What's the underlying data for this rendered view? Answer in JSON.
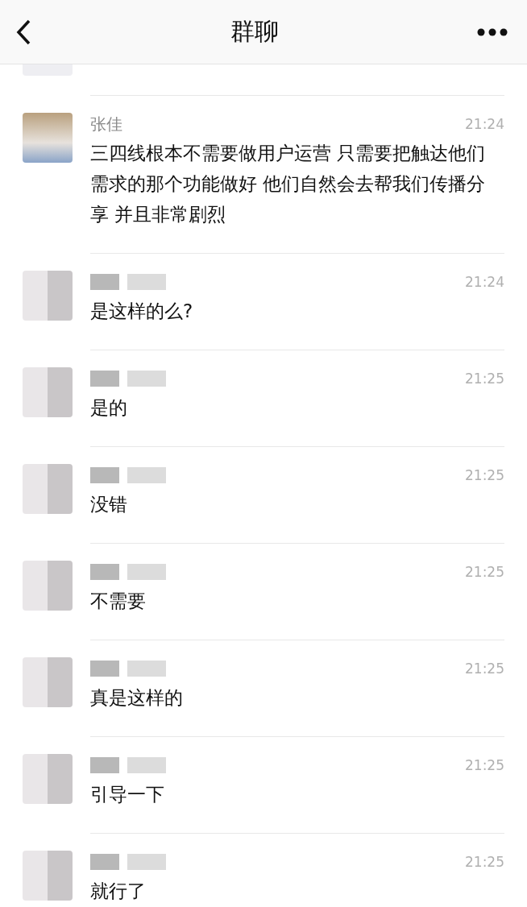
{
  "header": {
    "title": "群聊"
  },
  "messages": [
    {
      "kind": "named",
      "sender": "张佳",
      "time": "21:24",
      "text": "三四线根本不需要做用户运营 只需要把触达他们需求的那个功能做好 他们自然会去帮我们传播分享 并且非常剧烈"
    },
    {
      "kind": "obscured",
      "time": "21:24",
      "text": "是这样的么?"
    },
    {
      "kind": "obscured",
      "time": "21:25",
      "text": "是的"
    },
    {
      "kind": "obscured",
      "time": "21:25",
      "text": "没错"
    },
    {
      "kind": "obscured",
      "time": "21:25",
      "text": "不需要"
    },
    {
      "kind": "obscured",
      "time": "21:25",
      "text": "真是这样的"
    },
    {
      "kind": "obscured",
      "time": "21:25",
      "text": "引导一下"
    },
    {
      "kind": "obscured",
      "time": "21:25",
      "text": "就行了"
    }
  ]
}
